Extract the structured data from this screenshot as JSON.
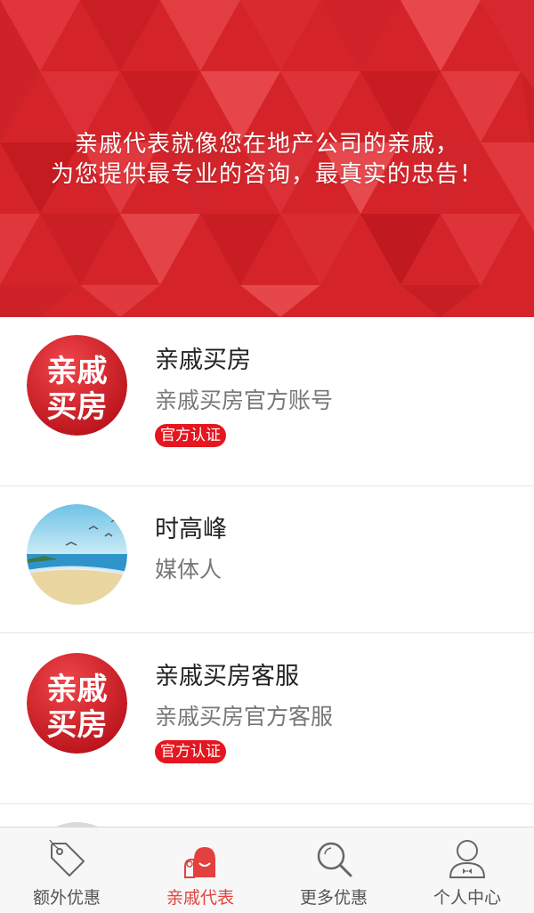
{
  "banner": {
    "line1": "亲戚代表就像您在地产公司的亲戚，",
    "line2": "为您提供最专业的咨询，最真实的忠告！"
  },
  "list": {
    "items": [
      {
        "avatar_text_1": "亲戚",
        "avatar_text_2": "买房",
        "name": "亲戚买房",
        "desc": "亲戚买房官方账号",
        "badge": "官方认证"
      },
      {
        "name": "时高峰",
        "desc": "媒体人"
      },
      {
        "avatar_text_1": "亲戚",
        "avatar_text_2": "买房",
        "name": "亲戚买房客服",
        "desc": "亲戚买房官方客服",
        "badge": "官方认证"
      }
    ]
  },
  "tabbar": {
    "tabs": [
      {
        "label": "额外优惠",
        "icon": "tag-icon"
      },
      {
        "label": "亲戚代表",
        "icon": "people-icon",
        "active": true
      },
      {
        "label": "更多优惠",
        "icon": "search-icon"
      },
      {
        "label": "个人中心",
        "icon": "user-icon"
      }
    ]
  },
  "colors": {
    "brand_red": "#d8262b",
    "badge_red": "#e5161f",
    "active_tab": "#e3413d"
  }
}
